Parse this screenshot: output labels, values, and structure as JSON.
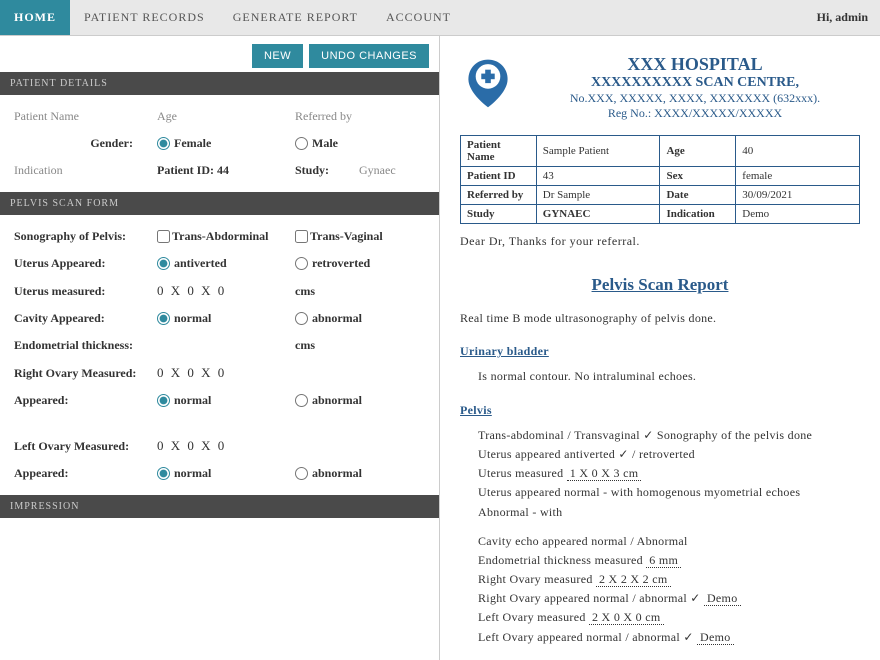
{
  "nav": {
    "home": "HOME",
    "patient_records": "PATIENT RECORDS",
    "generate_report": "GENERATE REPORT",
    "account": "ACCOUNT",
    "greeting": "Hi, admin"
  },
  "buttons": {
    "new": "NEW",
    "undo": "UNDO CHANGES"
  },
  "sections": {
    "patient_details": "PATIENT DETAILS",
    "pelvis_scan": "PELVIS SCAN FORM",
    "impression": "IMPRESSION"
  },
  "patient_form": {
    "name_label": "Patient Name",
    "age_label": "Age",
    "referred_label": "Referred by",
    "gender_label": "Gender:",
    "female": "Female",
    "male": "Male",
    "indication_label": "Indication",
    "patient_id_label": "Patient ID: 44",
    "study_label": "Study:",
    "study_value": "Gynaec"
  },
  "pelvis_form": {
    "sonography_label": "Sonography of Pelvis:",
    "trans_abdominal": "Trans-Abdorminal",
    "trans_vaginal": "Trans-Vaginal",
    "uterus_appeared_label": "Uterus Appeared:",
    "antiverted": "antiverted",
    "retroverted": "retroverted",
    "uterus_measured_label": "Uterus measured:",
    "measure_value": "0 X 0 X 0",
    "cms": "cms",
    "cavity_appeared_label": "Cavity Appeared:",
    "normal": "normal",
    "abnormal": "abnormal",
    "endometrial_label": "Endometrial thickness:",
    "right_ovary_label": "Right Ovary Measured:",
    "appeared_label": "Appeared:",
    "left_ovary_label": "Left Ovary Measured:"
  },
  "report": {
    "hospital_name": "XXX HOSPITAL",
    "scan_centre": "XXXXXXXXXX SCAN CENTRE,",
    "address": "No.XXX, XXXXX, XXXX, XXXXXXX (632xxx).",
    "reg_no": "Reg No.: XXXX/XXXXX/XXXXX",
    "table": {
      "name_lbl": "Patient Name",
      "name_val": "Sample Patient",
      "age_lbl": "Age",
      "age_val": "40",
      "id_lbl": "Patient ID",
      "id_val": "43",
      "sex_lbl": "Sex",
      "sex_val": "female",
      "ref_lbl": "Referred by",
      "ref_val": "Dr Sample",
      "date_lbl": "Date",
      "date_val": "30/09/2021",
      "study_lbl": "Study",
      "study_val": "GYNAEC",
      "ind_lbl": "Indication",
      "ind_val": "Demo"
    },
    "referral": "Dear Dr, Thanks for your referral.",
    "title": "Pelvis Scan Report",
    "intro": "Real time B mode ultrasonography of pelvis done.",
    "bladder_title": "Urinary bladder",
    "bladder_text": "Is normal contour. No intraluminal echoes.",
    "pelvis_title": "Pelvis",
    "pelvis_lines": {
      "l1": "Trans-abdominal / Transvaginal ✓ Sonography of the pelvis done",
      "l2a": "Uterus appeared antiverted ✓ / retroverted",
      "l3a": "Uterus measured ",
      "l3u": "1 X 0 X 3 cm",
      "l4": "Uterus appeared normal - with homogenous myometrial echoes",
      "l5": "Abnormal - with",
      "l6": "Cavity echo appeared normal / Abnormal",
      "l7a": "Endometrial thickness measured ",
      "l7u": "6 mm",
      "l8a": "Right Ovary measured ",
      "l8u": "2 X 2 X 2 cm",
      "l9a": "Right Ovary appeared normal / abnormal ✓ ",
      "l9u": "Demo",
      "l10a": "Left Ovary measured ",
      "l10u": "2 X 0 X 0 cm",
      "l11a": "Left Ovary appeared normal / abnormal ✓ ",
      "l11u": "Demo"
    }
  }
}
